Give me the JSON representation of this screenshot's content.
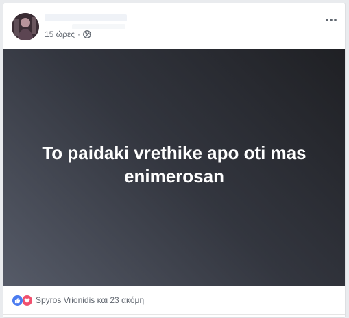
{
  "post": {
    "time": "15 ώρες",
    "separator": "·",
    "privacy_icon": "globe-icon",
    "more_icon": "more-options-icon",
    "text": "To paidaki vrethike apo oti mas enimerosan",
    "reactions": {
      "icons": [
        "like-icon",
        "love-icon"
      ],
      "summary": "Spyros Vrionidis και 23 ακόμη",
      "like_color": "#4b7cf0",
      "love_color": "#f0506e"
    },
    "media_gradient": [
      "#1f2024",
      "#565b68"
    ]
  }
}
